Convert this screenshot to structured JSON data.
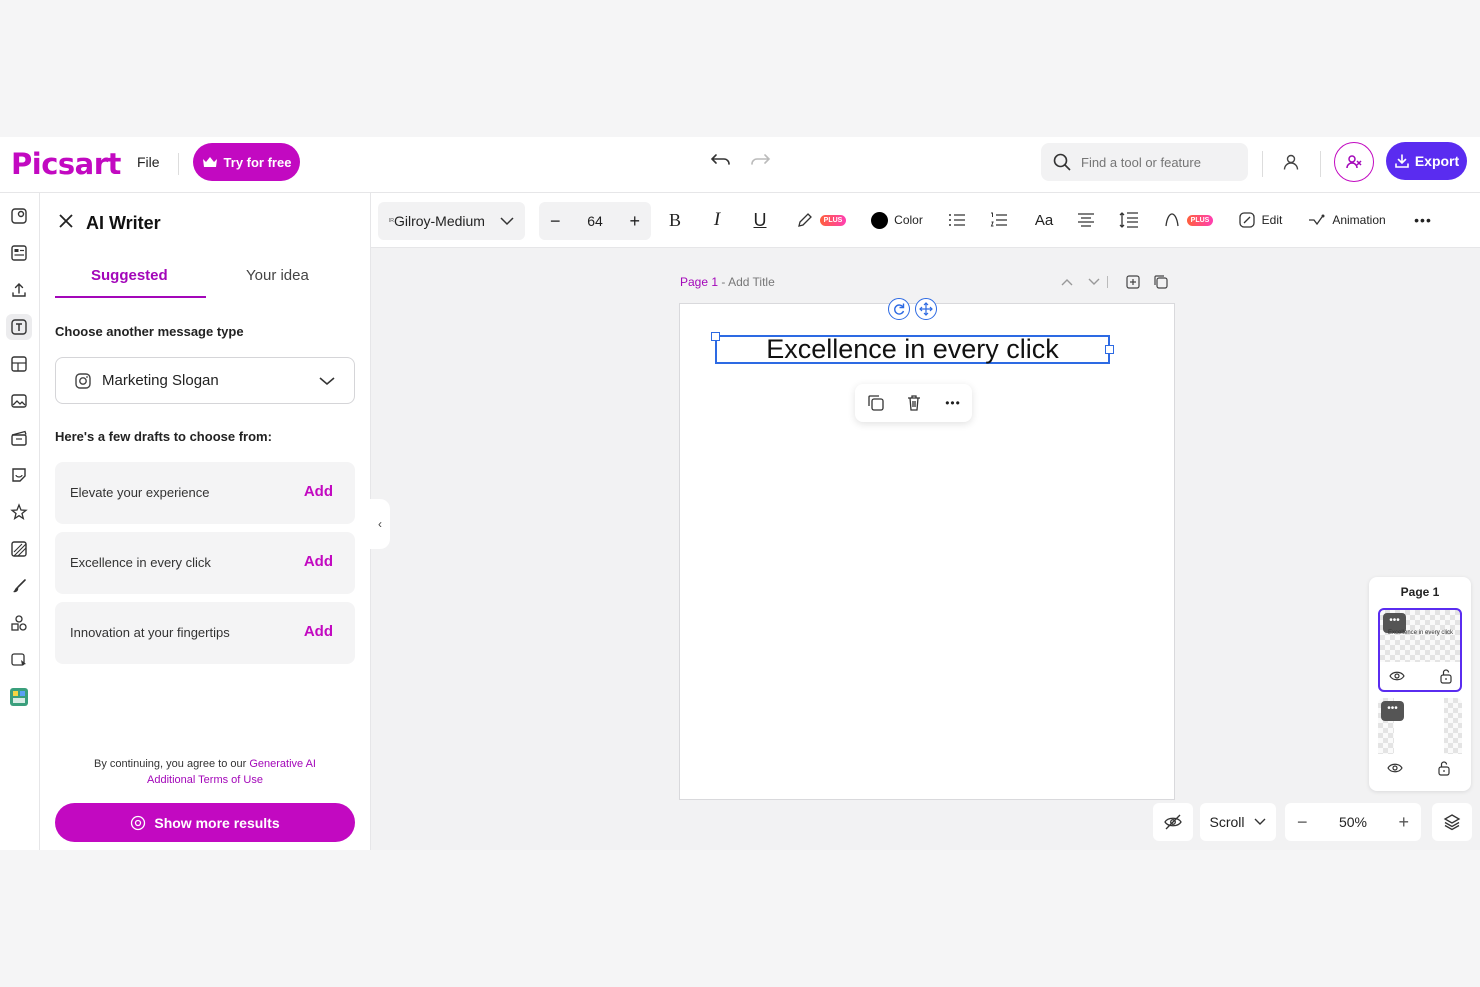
{
  "header": {
    "logo": "Picsart",
    "file_menu": "File",
    "try_button": "Try for free",
    "search_placeholder": "Find a tool or feature",
    "export_button": "Export"
  },
  "panel": {
    "title": "AI Writer",
    "tabs": [
      {
        "label": "Suggested",
        "active": true
      },
      {
        "label": "Your idea",
        "active": false
      }
    ],
    "choose_label": "Choose another message type",
    "message_type": "Marketing Slogan",
    "drafts_label": "Here's a few drafts to choose from:",
    "drafts": [
      {
        "text": "Elevate your experience",
        "action": "Add"
      },
      {
        "text": "Excellence in every click",
        "action": "Add"
      },
      {
        "text": "Innovation at your fingertips",
        "action": "Add"
      }
    ],
    "terms_prefix": "By continuing, you agree to our",
    "terms_link_1": "Generative AI",
    "terms_link_2": "Additional Terms of Use",
    "show_more": "Show more results"
  },
  "toolbar": {
    "font_prefix": "ᴵᴿ",
    "font_name": "Gilroy-Medium",
    "font_size": "64",
    "plus_badge": "PLUS",
    "color_label": "Color",
    "edit_label": "Edit",
    "animation_label": "Animation"
  },
  "canvas": {
    "page_label": "Page 1",
    "separator": "-",
    "title_placeholder": "Add Title",
    "text": "Excellence in every click"
  },
  "layers": {
    "title": "Page 1",
    "thumb_text": "Excellence in every click",
    "thumb_dots": "•••"
  },
  "bottom": {
    "scroll_label": "Scroll",
    "zoom": "50%"
  },
  "colors": {
    "brand": "#c209c1",
    "accent": "#5a2cf0",
    "selection": "#2d6ae3"
  }
}
